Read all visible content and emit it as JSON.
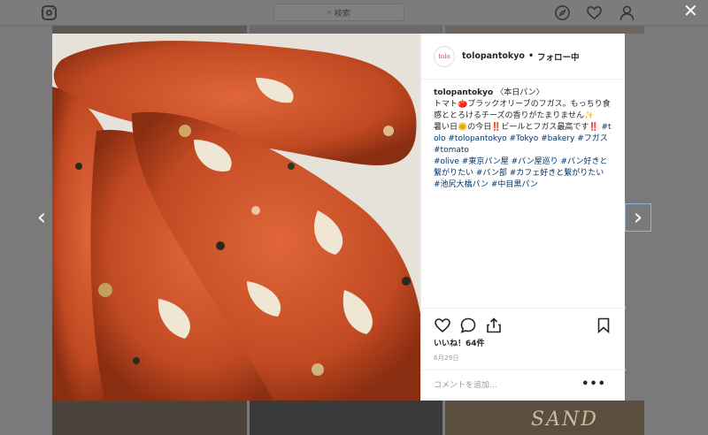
{
  "topbar": {
    "search_placeholder": "検索"
  },
  "icons": {
    "logo": "instagram-icon",
    "explore": "compass-icon",
    "activity": "heart-icon",
    "profile": "person-icon",
    "close": "close-icon"
  },
  "post": {
    "username": "tolopantokyo",
    "avatar_text": "tolo",
    "separator": "•",
    "follow_status": "フォロー中",
    "caption": {
      "username": "tolopantokyo",
      "lines": [
        "〈本日パン〉",
        "トマト🍅ブラックオリーブのフガス。もっちり食感ととろけるチーズの香りがたまりません✨",
        "暑い日🌞の今日‼️ビールとフガス最高です‼️"
      ],
      "tags_inline": "#tolo #tolopantokyo #Tokyo #bakery #フガス #tomato",
      "tags_line2": "#olive #東京パン屋 #パン屋巡り #パン好きと繋がりたい #パン部 #カフェ好きと繋がりたい",
      "tags_line3": "#池尻大橋パン #中目黒パン"
    },
    "likes": "いいね！64件",
    "date": "6月29日",
    "comment_placeholder": "コメントを追加...",
    "more_label": "•••"
  },
  "background": {
    "sand_text": "SAND"
  },
  "nav": {
    "prev": "‹",
    "next": "›",
    "close": "✕"
  },
  "colors": {
    "overlay": "#7a7a7a",
    "hashtag": "#003569",
    "text": "#262626",
    "muted": "#999999"
  }
}
